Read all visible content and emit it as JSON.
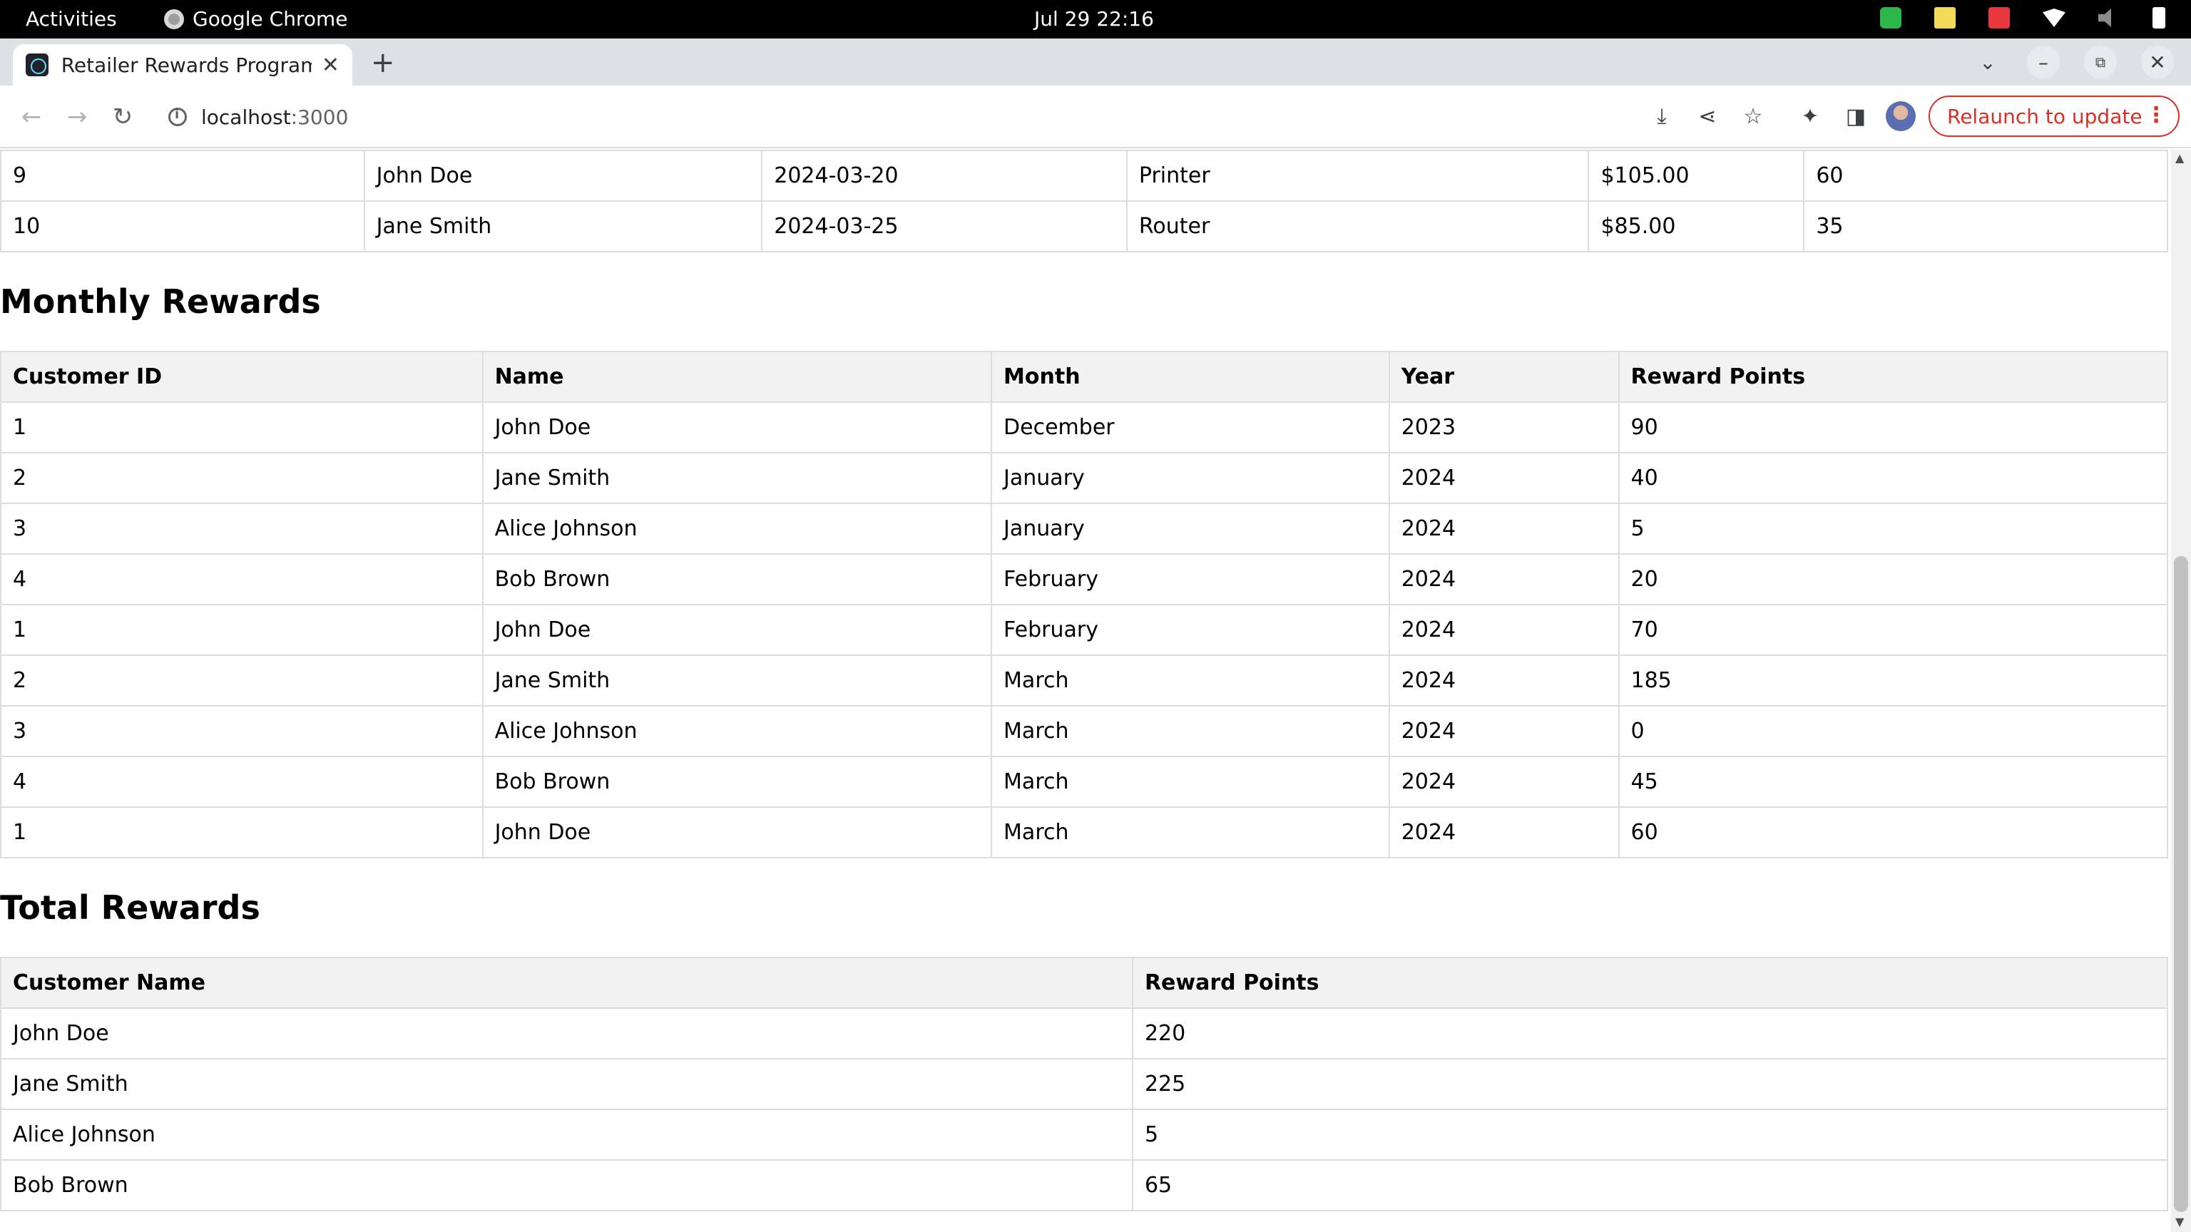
{
  "os": {
    "activities": "Activities",
    "app_name": "Google Chrome",
    "clock": "Jul 29  22:16"
  },
  "browser": {
    "tab_title": "Retailer Rewards Program",
    "url_host": "localhost",
    "url_port": ":3000",
    "relaunch_label": "Relaunch to update"
  },
  "transactions_tail": {
    "rows": [
      [
        "9",
        "John Doe",
        "2024-03-20",
        "Printer",
        "$105.00",
        "60"
      ],
      [
        "10",
        "Jane Smith",
        "2024-03-25",
        "Router",
        "$85.00",
        "35"
      ]
    ]
  },
  "monthly": {
    "heading": "Monthly Rewards",
    "headers": [
      "Customer ID",
      "Name",
      "Month",
      "Year",
      "Reward Points"
    ],
    "rows": [
      [
        "1",
        "John Doe",
        "December",
        "2023",
        "90"
      ],
      [
        "2",
        "Jane Smith",
        "January",
        "2024",
        "40"
      ],
      [
        "3",
        "Alice Johnson",
        "January",
        "2024",
        "5"
      ],
      [
        "4",
        "Bob Brown",
        "February",
        "2024",
        "20"
      ],
      [
        "1",
        "John Doe",
        "February",
        "2024",
        "70"
      ],
      [
        "2",
        "Jane Smith",
        "March",
        "2024",
        "185"
      ],
      [
        "3",
        "Alice Johnson",
        "March",
        "2024",
        "0"
      ],
      [
        "4",
        "Bob Brown",
        "March",
        "2024",
        "45"
      ],
      [
        "1",
        "John Doe",
        "March",
        "2024",
        "60"
      ]
    ]
  },
  "total": {
    "heading": "Total Rewards",
    "headers": [
      "Customer Name",
      "Reward Points"
    ],
    "rows": [
      [
        "John Doe",
        "220"
      ],
      [
        "Jane Smith",
        "225"
      ],
      [
        "Alice Johnson",
        "5"
      ],
      [
        "Bob Brown",
        "65"
      ]
    ]
  }
}
